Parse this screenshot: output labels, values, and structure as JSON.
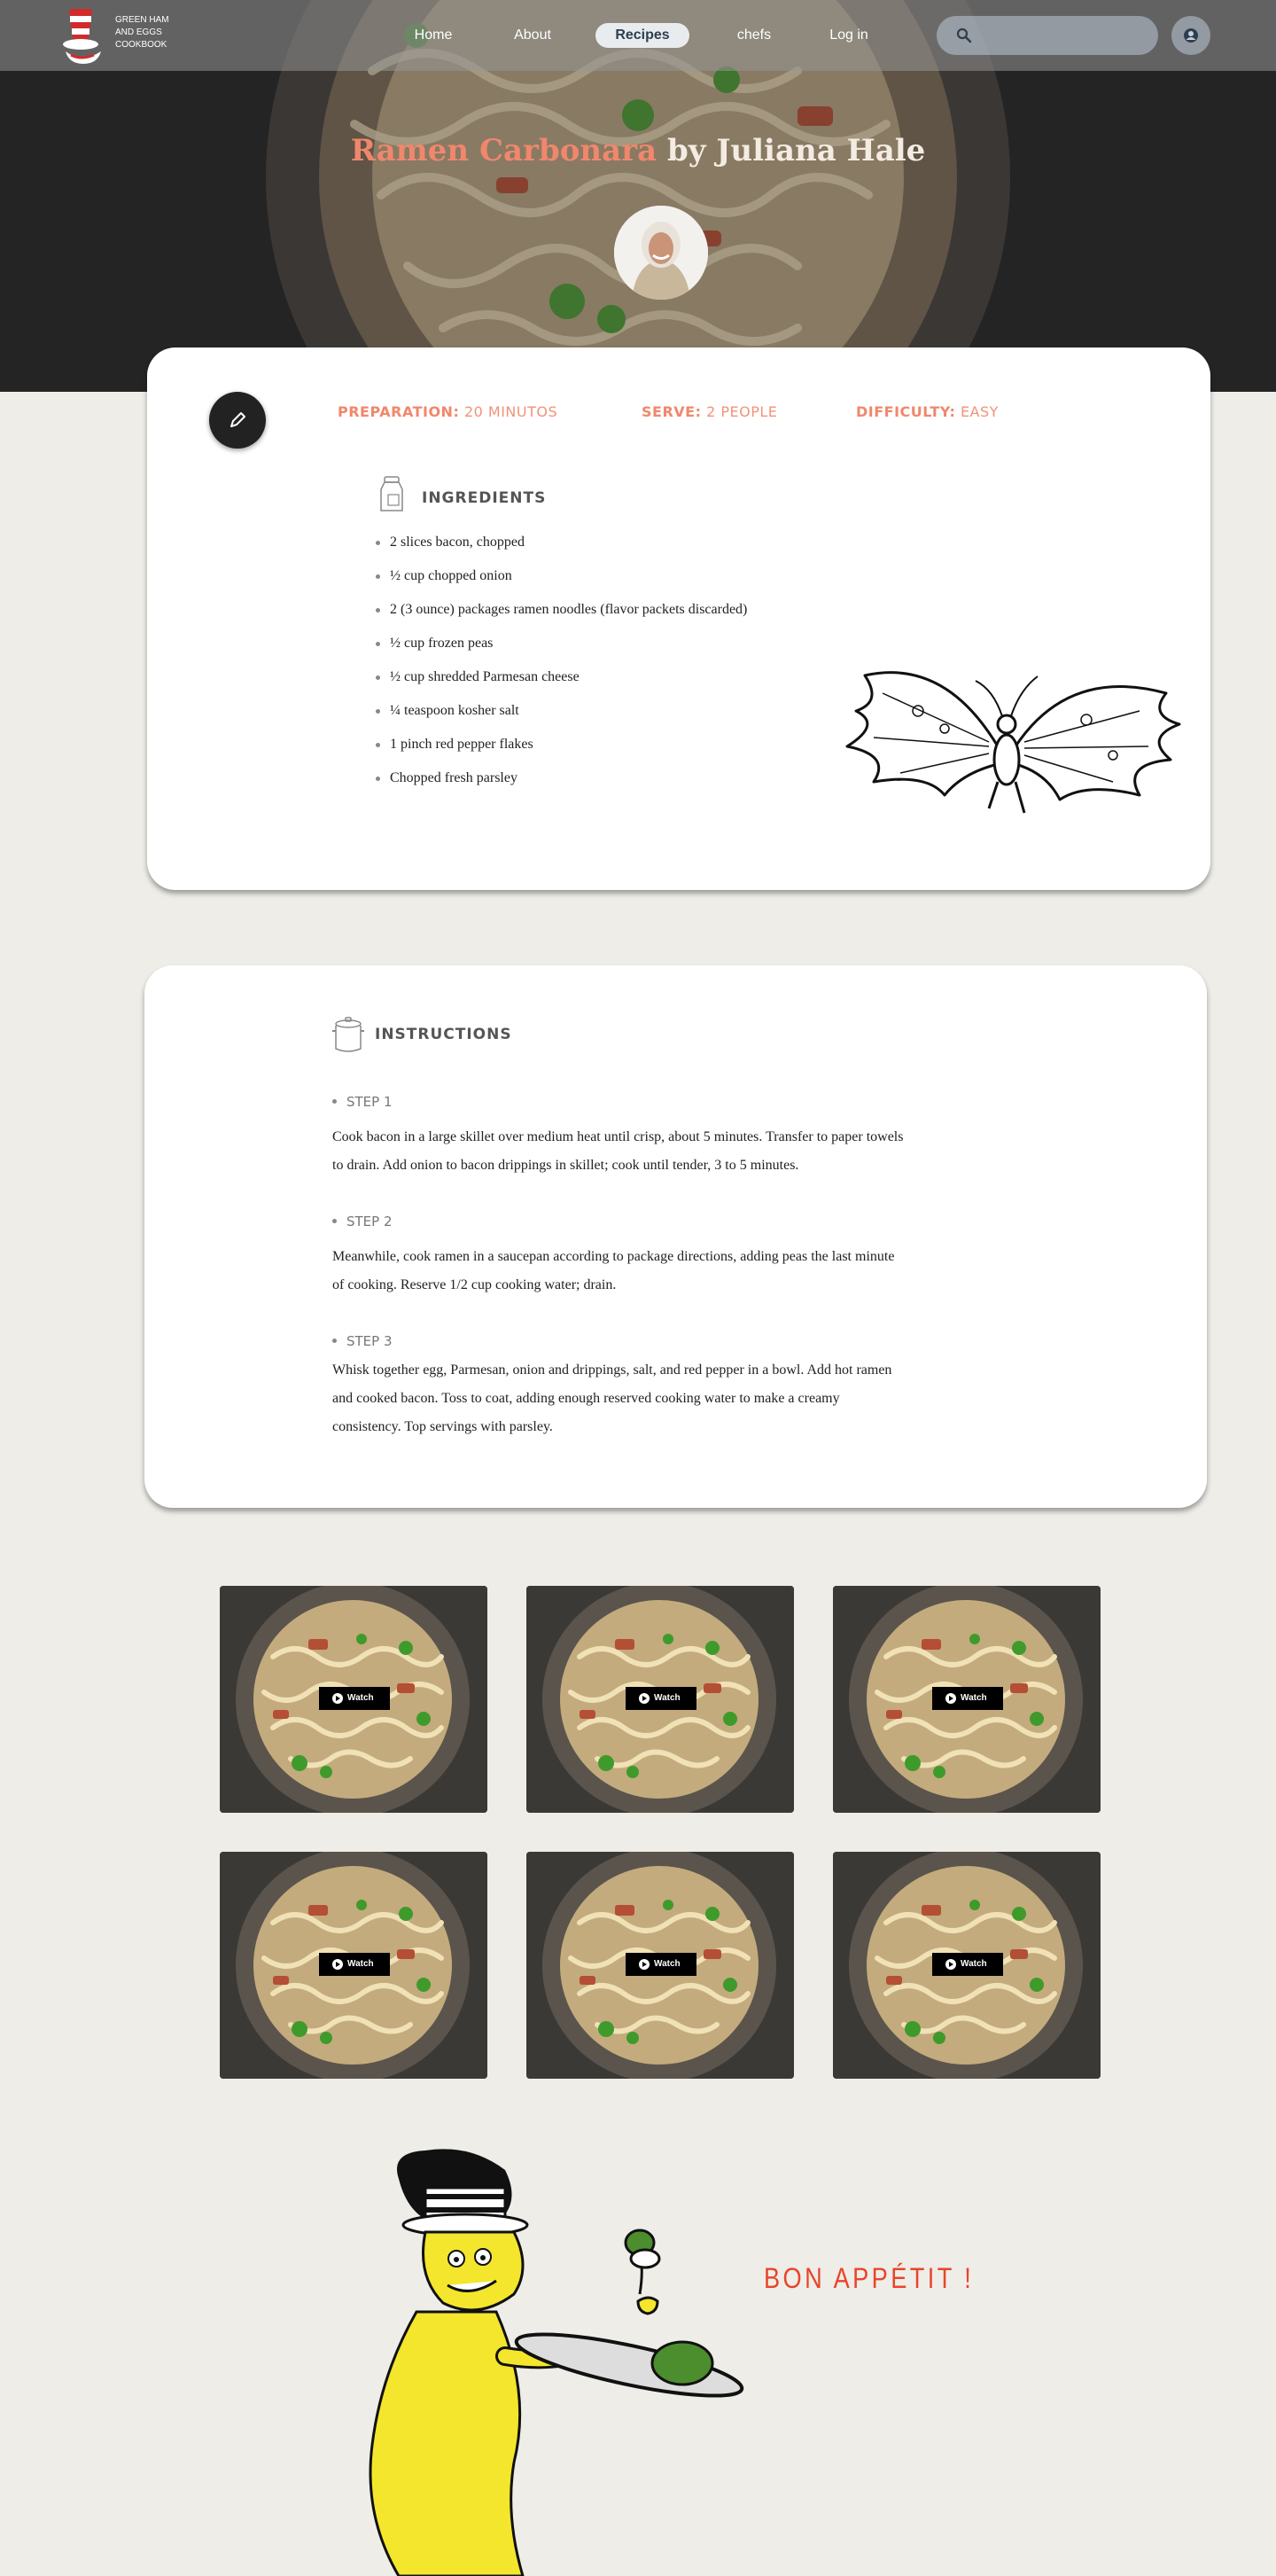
{
  "brand": {
    "logo_lines": [
      "GREEN HAM",
      "AND EGGS",
      "COOKBOOK"
    ]
  },
  "nav": {
    "items": [
      {
        "label": "Home"
      },
      {
        "label": "About"
      },
      {
        "label": "Recipes"
      },
      {
        "label": "chefs"
      },
      {
        "label": "Log in"
      }
    ],
    "active": "Recipes",
    "search_placeholder": "",
    "search_icon": "search-icon",
    "user_icon": "account-circle-icon"
  },
  "recipe": {
    "name": "Ramen Carbonara",
    "by": "by Juliana Hale",
    "meta": {
      "prep_label": "PREPARATION:",
      "prep_value": "20 MINUTOS",
      "serve_label": "SERVE:",
      "serve_value": "2 PEOPLE",
      "difficulty_label": "DIFFICULTY:",
      "difficulty_value": "EASY"
    },
    "ingredients_title": "INGREDIENTS",
    "ingredients": [
      "2 slices bacon, chopped",
      "½ cup chopped onion",
      "2 (3 ounce) packages ramen noodles (flavor packets discarded)",
      "½ cup frozen peas",
      "½ cup shredded Parmesan cheese",
      "¼ teaspoon kosher salt",
      "1 pinch red pepper flakes",
      "Chopped fresh parsley"
    ],
    "instructions_title": "INSTRUCTIONS",
    "steps": [
      {
        "label": "STEP 1",
        "text": "Cook bacon in a large skillet over medium heat until crisp, about 5 minutes. Transfer to paper towels to drain. Add onion to bacon drippings in skillet; cook until tender, 3 to 5 minutes."
      },
      {
        "label": "STEP 2",
        "text": "Meanwhile, cook ramen in a saucepan according to package directions, adding peas the last minute of cooking. Reserve 1/2 cup cooking water; drain."
      },
      {
        "label": "STEP 3",
        "text": "Whisk together egg, Parmesan, onion and drippings, salt, and red pepper in a bowl. Add hot ramen and cooked bacon. Toss to coat, adding enough reserved cooking water to make a creamy consistency. Top servings with parsley."
      }
    ]
  },
  "videos": {
    "watch_label": "Watch",
    "count": 6
  },
  "footer": {
    "tagline": "BON APPÉTIT !"
  },
  "colors": {
    "accent": "#f0876c",
    "footer_accent": "#e8452a",
    "page_bg": "#eeede8"
  }
}
